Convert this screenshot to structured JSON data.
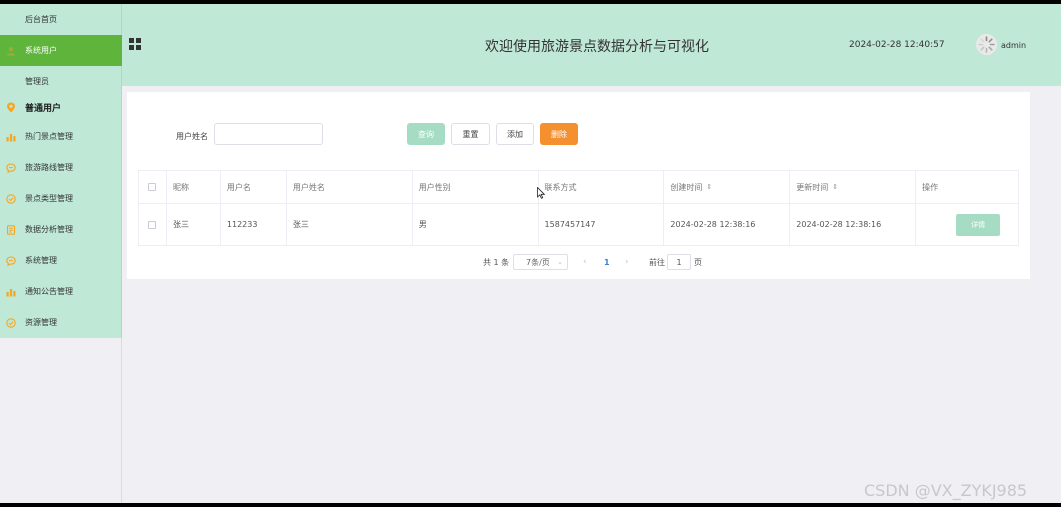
{
  "sidebar": {
    "items": [
      {
        "label": "后台首页",
        "icon": "none",
        "kind": "sub"
      },
      {
        "label": "系统用户",
        "icon": "user-icon",
        "kind": "active"
      },
      {
        "label": "管理员",
        "icon": "none",
        "kind": "sub"
      },
      {
        "label": "普通用户",
        "icon": "location-pin-icon",
        "kind": "group"
      },
      {
        "label": "热门景点管理",
        "icon": "bar-chart-icon",
        "kind": "normal"
      },
      {
        "label": "旅游路线管理",
        "icon": "chat-icon",
        "kind": "normal"
      },
      {
        "label": "景点类型管理",
        "icon": "check-circle-icon",
        "kind": "normal"
      },
      {
        "label": "数据分析管理",
        "icon": "document-icon",
        "kind": "normal"
      },
      {
        "label": "系统管理",
        "icon": "chat-icon",
        "kind": "normal"
      },
      {
        "label": "通知公告管理",
        "icon": "bar-chart-icon",
        "kind": "normal"
      },
      {
        "label": "资源管理",
        "icon": "check-circle-icon",
        "kind": "normal"
      }
    ]
  },
  "header": {
    "title": "欢迎使用旅游景点数据分析与可视化",
    "datetime": "2024-02-28 12:40:57",
    "username": "admin"
  },
  "search": {
    "label": "用户姓名",
    "value": "",
    "placeholder": ""
  },
  "buttons": {
    "query": "查询",
    "reset": "重置",
    "add": "添加",
    "delete": "删除"
  },
  "table": {
    "columns": [
      "昵称",
      "用户名",
      "用户姓名",
      "用户性别",
      "联系方式",
      "创建时间",
      "更新时间",
      "操作"
    ],
    "rows": [
      {
        "nickname": "张三",
        "username": "112233",
        "realname": "张三",
        "gender": "男",
        "phone": "1587457147",
        "created": "2024-02-28 12:38:16",
        "updated": "2024-02-28 12:38:16",
        "action": "详情"
      }
    ]
  },
  "pagination": {
    "total": "共 1 条",
    "page_size": "7条/页",
    "current_page": "1",
    "goto_label": "前往",
    "goto_value": "1",
    "goto_unit": "页"
  },
  "watermark": "CSDN @VX_ZYKJ985",
  "colors": {
    "sidebar_bg": "#bfe8d7",
    "active_item": "#5fb43b",
    "query_button": "#a7dcc4",
    "delete_button": "#f5902f",
    "icon_orange": "#f5a623"
  }
}
